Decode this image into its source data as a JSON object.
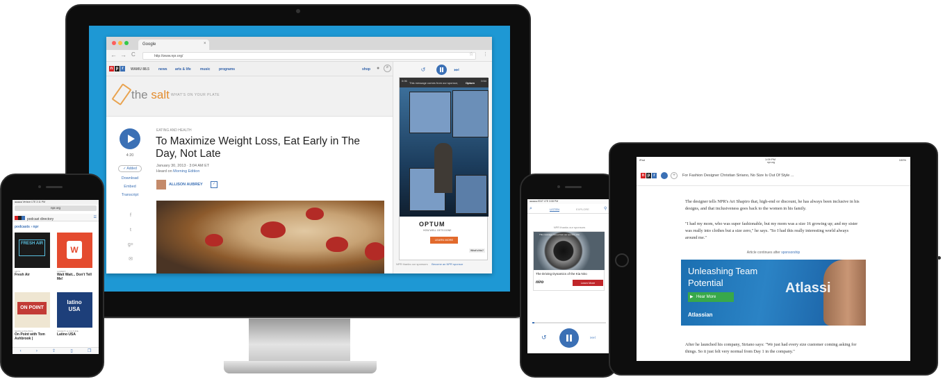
{
  "imac": {
    "browser": {
      "tab_title": "Google",
      "tab_close": "×",
      "url": "http://www.npr.org/",
      "nav_back": "←",
      "nav_forward": "→",
      "nav_reload": "C"
    },
    "npr_nav": {
      "logo": [
        "n",
        "p",
        "r"
      ],
      "station": "WAMU 88.5",
      "items": [
        "news",
        "arts & life",
        "music",
        "programs"
      ],
      "shop": "shop"
    },
    "salt": {
      "title_pre": "the",
      "title_bold": "salt",
      "tagline": "WHAT'S ON YOUR PLATE"
    },
    "article": {
      "kicker": "EATING AND HEALTH",
      "headline": "To Maximize Weight Loss, Eat Early in The Day, Not Late",
      "date": "January 30, 2013 · 3:04 AM ET",
      "heard_on_label": "Heard on",
      "heard_on_show": "Morning Edition",
      "author": "ALLISON AUBREY",
      "duration": "4:20",
      "added_label": "✓ Added",
      "links": [
        "Download",
        "Embed",
        "Transcript"
      ],
      "social": [
        "f",
        "t",
        "g+",
        "✉"
      ]
    },
    "player": {
      "ad_message": "This message comes from our sponsor,",
      "ad_sponsor": "Optum",
      "ad_time_left": "0:06",
      "ad_time_right": "0:54",
      "ad_brand": "OPTUM",
      "ad_brand_sub": "HOW WELL GETS DONE",
      "ad_button": "LEARN MORE",
      "whats_this": "What's this?",
      "foot_thanks": "NPR thanks our sponsors",
      "foot_link": "Become an NPR sponsor"
    }
  },
  "left_phone": {
    "status": "●●●●● Verizon  LTE        2:11 PM",
    "url": "npr.org",
    "bar_title": "podcast directory",
    "section": "podcasts › npr",
    "tiles": [
      {
        "art": "FRESH AIR",
        "kicker": "ARTS",
        "caption": "Fresh Air"
      },
      {
        "art": "W",
        "kicker": "COMEDY",
        "caption": "Wait Wait... Don't Tell Me!"
      },
      {
        "art": "ON POINT",
        "kicker": "NEWS & POLITICS",
        "caption": "On Point with Tom Ashbrook |"
      },
      {
        "art": "latino USA",
        "kicker": "SOCIETY & CULTURE",
        "caption": "Latino USA"
      }
    ]
  },
  "right_phone": {
    "status": "●●●●● AT&T  LTE   3:08 PM",
    "tabs": [
      "LISTEN",
      "EXPLORE"
    ],
    "thanks": "NPR thanks our sponsors",
    "ad_caption": "The Driving Dynamics of the Kia Niro",
    "ad_brand": "niro",
    "ad_button": "Learn More",
    "ad_top_text": "This message comes from our sponsor, Kia"
  },
  "ipad": {
    "status_left": "iPad",
    "status_time": "1:09 PM",
    "status_url": "npr.org",
    "status_right": "100%",
    "bar_title": "For Fashion Designer Christian Siriano, No Size Is Out Of Style ...",
    "paragraphs": [
      "The designer tells NPR's Ari Shapiro that, high-end or discount, he has always been inclusive in his designs, and that inclusiveness goes back to the women in his family.",
      "\"I had my mom, who was super fashionable, but my mom was a size 16 growing up; and my sister was really into clothes but a size zero,\" he says. \"So I had this really interesting world always around me.\"",
      "After he launched his company, Siriano says: \"We just had every size customer coming asking for things. So it just felt very normal from Day 1 in the company.\""
    ],
    "continues": "Article continues after",
    "continues_link": "sponsorship",
    "ad_title": "Unleashing Team Potential",
    "ad_button": "Hear More",
    "ad_logo": "Atlassian",
    "ad_word": "Atlassi"
  },
  "colors": {
    "npr_blue": "#3b70b5",
    "npr_red": "#d62021",
    "screen_blue": "#1e98d4"
  }
}
